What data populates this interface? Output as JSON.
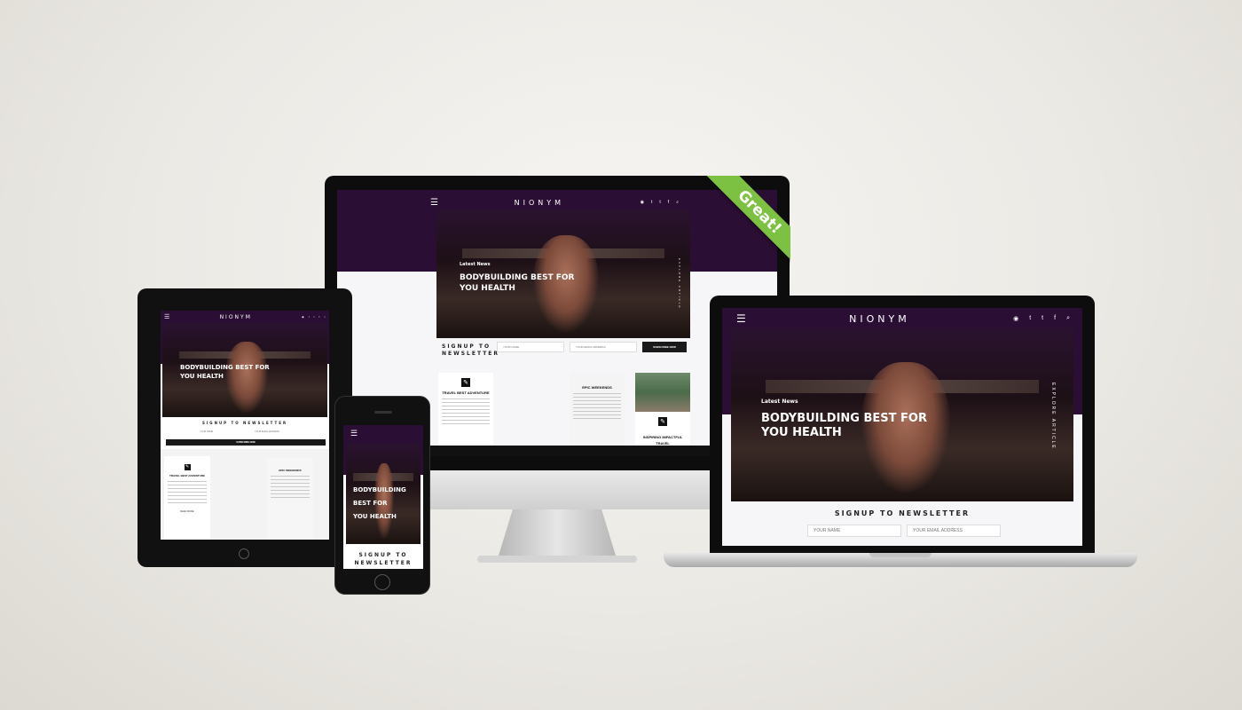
{
  "brand": {
    "logo": "NIONYM",
    "accent": "#2a0e33",
    "ribbon_color": "#7cc142"
  },
  "ribbon": {
    "label": "Great!"
  },
  "hero": {
    "tag": "Latest News",
    "title_line1": "BODYBUILDING BEST FOR",
    "title_line2": "YOU HEALTH",
    "vertical": "EXPLORE ARTICLE"
  },
  "newsletter": {
    "title": "SIGNUP TO NEWSLETTER",
    "title_line1": "SIGNUP TO",
    "title_line2": "NEWSLETTER",
    "name_placeholder": "YOUR NAME",
    "email_placeholder": "YOUR EMAIL ADDRESS",
    "button": "SUBSCRIBE NOW"
  },
  "posts": [
    {
      "title": "TRAVEL BEST ADVENTURE",
      "icon": "pencil-icon"
    },
    {
      "title": "EPIC WEEKENDS",
      "icon": ""
    },
    {
      "title_line1": "INSPIRING IMPACTFUL",
      "title_line2": "TRAVEL",
      "icon": "pencil-icon"
    }
  ],
  "readmore": "READ MORE",
  "social_icons": [
    "rss-icon",
    "twitter-icon",
    "tumblr-icon",
    "facebook-icon",
    "search-icon"
  ]
}
